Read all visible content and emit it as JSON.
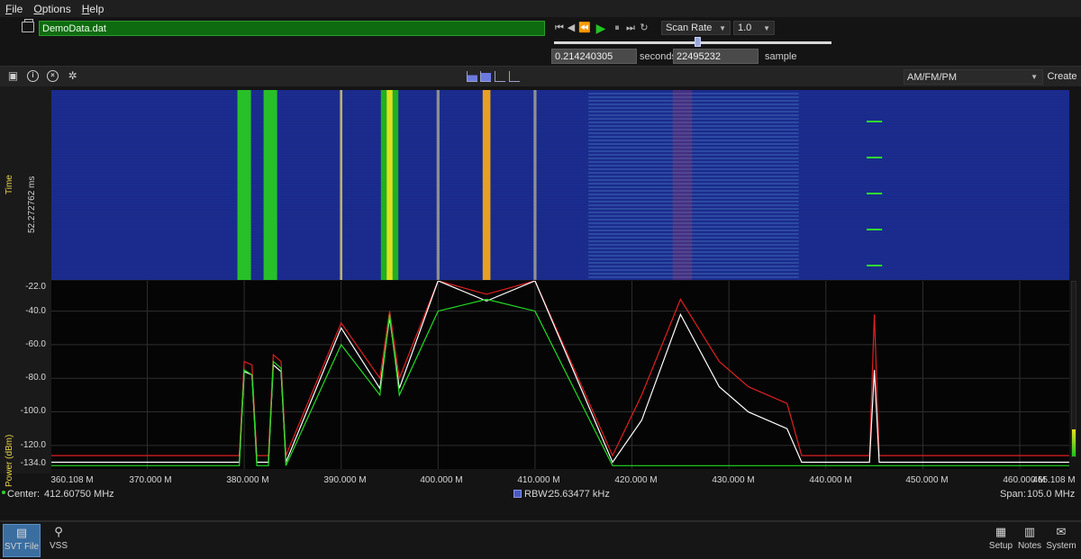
{
  "menu": [
    "File",
    "Options",
    "Help"
  ],
  "file": {
    "name": "DemoData.dat",
    "icon": "folder-open-icon"
  },
  "transport": {
    "buttons": [
      "skip-start-icon",
      "step-back-icon",
      "rewind-icon",
      "play-icon",
      "pause-icon",
      "skip-end-icon",
      "loop-icon"
    ],
    "rate_mode": "Scan Rate",
    "rate_value": "1.0",
    "position_fraction": 0.515,
    "time_value": "0.214240305",
    "time_unit": "seconds",
    "sample_value": "22495232",
    "sample_unit": "sample"
  },
  "toolbar": {
    "icons": [
      "save-icon",
      "info-icon",
      "close-circle-icon",
      "gear-icon"
    ],
    "view_modes": [
      "spectrum-mode-icon",
      "spectrogram-mode-icon",
      "trace-mode-icon",
      "waterfall-mode-icon"
    ],
    "demod_mode": "AM/FM/PM",
    "create_label": "Create"
  },
  "spectrogram": {
    "ylabel": "Time",
    "time_span": "52.272762 ms"
  },
  "spectrum": {
    "ylabel": "Power (dBm)",
    "y_ticks": [
      "-22.0",
      "-40.0",
      "-60.0",
      "-80.0",
      "-100.0",
      "-120.0",
      "-134.0"
    ],
    "x_ticks": [
      "360.108 M",
      "370.000 M",
      "380.000 M",
      "390.000 M",
      "400.000 M",
      "410.000 M",
      "420.000 M",
      "430.000 M",
      "440.000 M",
      "450.000 M",
      "460.000 M",
      "465.108 M"
    ]
  },
  "chart_data": {
    "type": "line",
    "xlabel": "",
    "ylabel": "Power (dBm)",
    "xlim": [
      360.108,
      465.108
    ],
    "ylim": [
      -134,
      -22
    ],
    "x_unit": "MHz",
    "series": [
      {
        "x": [
          360.1,
          379.5,
          380.0,
          380.8,
          381.3,
          382.5,
          383.0,
          383.8,
          384.3,
          390.0,
          394.0,
          395.0,
          396.0,
          400.0,
          405.0,
          410.0,
          418.0,
          421.0,
          425.0,
          429.0,
          432.0,
          436.0,
          437.5,
          444.5,
          445.0,
          445.5,
          450.0,
          465.1
        ],
        "y": [
          -126,
          -126,
          -70,
          -72,
          -126,
          -126,
          -66,
          -70,
          -126,
          -47,
          -80,
          -40,
          -80,
          -22,
          -30,
          -22,
          -126,
          -90,
          -33,
          -70,
          -85,
          -95,
          -126,
          -126,
          -42,
          -126,
          -126,
          -126
        ]
      },
      {
        "x": [
          360.1,
          379.5,
          380.0,
          380.8,
          381.3,
          382.5,
          383.0,
          383.8,
          384.3,
          390.0,
          394.0,
          395.0,
          396.0,
          400.0,
          405.0,
          410.0,
          418.0,
          421.0,
          425.0,
          429.0,
          432.0,
          436.0,
          437.5,
          444.5,
          445.0,
          445.5,
          450.0,
          465.1
        ],
        "y": [
          -130,
          -130,
          -76,
          -78,
          -130,
          -130,
          -72,
          -76,
          -130,
          -50,
          -86,
          -44,
          -86,
          -22,
          -34,
          -22,
          -130,
          -105,
          -42,
          -85,
          -100,
          -110,
          -130,
          -130,
          -75,
          -130,
          -130,
          -130
        ]
      },
      {
        "x": [
          360.1,
          379.5,
          380.0,
          380.8,
          381.3,
          382.5,
          383.0,
          383.8,
          384.3,
          390.0,
          394.0,
          395.0,
          396.0,
          400.0,
          405.0,
          410.0,
          418.0,
          450.0,
          465.1
        ],
        "y": [
          -132,
          -132,
          -75,
          -78,
          -132,
          -132,
          -70,
          -74,
          -132,
          -60,
          -90,
          -42,
          -90,
          -40,
          -33,
          -40,
          -132,
          -132,
          -132
        ]
      }
    ]
  },
  "info": {
    "center_label": "Center:",
    "center_value": "412.60750 MHz",
    "rbw_label": "RBW:",
    "rbw_value": "25.63477 kHz",
    "span_label": "Span:",
    "span_value": "105.0 MHz"
  },
  "taskbar": {
    "left": [
      {
        "label": "SVT File",
        "icon": "file-icon"
      },
      {
        "label": "VSS",
        "icon": "antenna-icon"
      }
    ],
    "right": [
      {
        "label": "Setup",
        "icon": "setup-icon"
      },
      {
        "label": "Notes",
        "icon": "notes-icon"
      },
      {
        "label": "System",
        "icon": "mail-icon"
      }
    ]
  },
  "colors": {
    "waterfall_bg": "#1a2a8a",
    "max_trace": "#e02020",
    "avg_trace": "#ffffff",
    "min_trace": "#22dd22",
    "accent": "#3b6ea0"
  }
}
